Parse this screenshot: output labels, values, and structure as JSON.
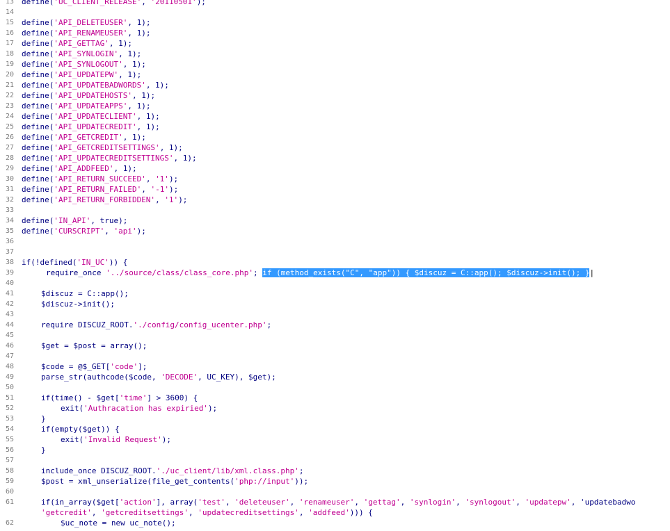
{
  "editor": {
    "line_numbers": [
      "13",
      "14",
      "15",
      "16",
      "17",
      "18",
      "19",
      "20",
      "21",
      "22",
      "23",
      "24",
      "25",
      "26",
      "27",
      "28",
      "29",
      "30",
      "31",
      "32",
      "33",
      "34",
      "35",
      "36",
      "37",
      "38",
      "39",
      "40",
      "41",
      "42",
      "43",
      "44",
      "45",
      "46",
      "47",
      "48",
      "49",
      "50",
      "51",
      "52",
      "53",
      "54",
      "55",
      "56",
      "57",
      "58",
      "59",
      "60",
      "61",
      "62"
    ],
    "lines": {
      "l13": "define('UC_CLIENT_RELEASE', '20110501');",
      "l15": "define('API_DELETEUSER', 1);",
      "l16": "define('API_RENAMEUSER', 1);",
      "l17": "define('API_GETTAG', 1);",
      "l18": "define('API_SYNLOGIN', 1);",
      "l19": "define('API_SYNLOGOUT', 1);",
      "l20": "define('API_UPDATEPW', 1);",
      "l21": "define('API_UPDATEBADWORDS', 1);",
      "l22": "define('API_UPDATEHOSTS', 1);",
      "l23": "define('API_UPDATEAPPS', 1);",
      "l24": "define('API_UPDATECLIENT', 1);",
      "l25": "define('API_UPDATECREDIT', 1);",
      "l26": "define('API_GETCREDIT', 1);",
      "l27": "define('API_GETCREDITSETTINGS', 1);",
      "l28": "define('API_UPDATECREDITSETTINGS', 1);",
      "l29": "define('API_ADDFEED', 1);",
      "l30": "define('API_RETURN_SUCCEED', '1');",
      "l31": "define('API_RETURN_FAILED', '-1');",
      "l32": "define('API_RETURN_FORBIDDEN', '1');",
      "l34": "define('IN_API', true);",
      "l35": "define('CURSCRIPT', 'api');",
      "l38": "if(!defined('IN_UC')) {",
      "l39_main": "require_once '../source/class/class_core.php'; ",
      "l39_selected": "if (method_exists(\"C\", \"app\")) { $discuz = C::app(); $discuz->init(); }",
      "l41": "$discuz = C::app();",
      "l42": "$discuz->init();",
      "l44": "require DISCUZ_ROOT.'./config/config_ucenter.php';",
      "l46": "$get = $post = array();",
      "l48": "$code = @$_GET['code'];",
      "l49": "parse_str(authcode($code, 'DECODE', UC_KEY), $get);",
      "l51": "if(time() - $get['time'] > 3600) {",
      "l52": "exit('Authracation has expiried');",
      "l53": "}",
      "l54": "if(empty($get)) {",
      "l55": "exit('Invalid Request');",
      "l56": "}",
      "l58": "include_once DISCUZ_ROOT.'./uc_client/lib/xml.class.php';",
      "l59": "$post = xml_unserialize(file_get_contents('php://input'));",
      "l61a": "if(in_array($get['action'], array('test', 'deleteuser', 'renameuser', 'gettag', 'synlogin', 'synlogout', 'updatepw', 'updatebadwo",
      "l61b": "'getcredit', 'getcreditsettings', 'updatecreditsettings', 'addfeed'))) {",
      "l62": "$uc_note = new uc_note();"
    }
  },
  "colors": {
    "keyword": "#000080",
    "string": "#c00090",
    "line_number": "#7f7f7f",
    "selection": "#3399ff"
  }
}
